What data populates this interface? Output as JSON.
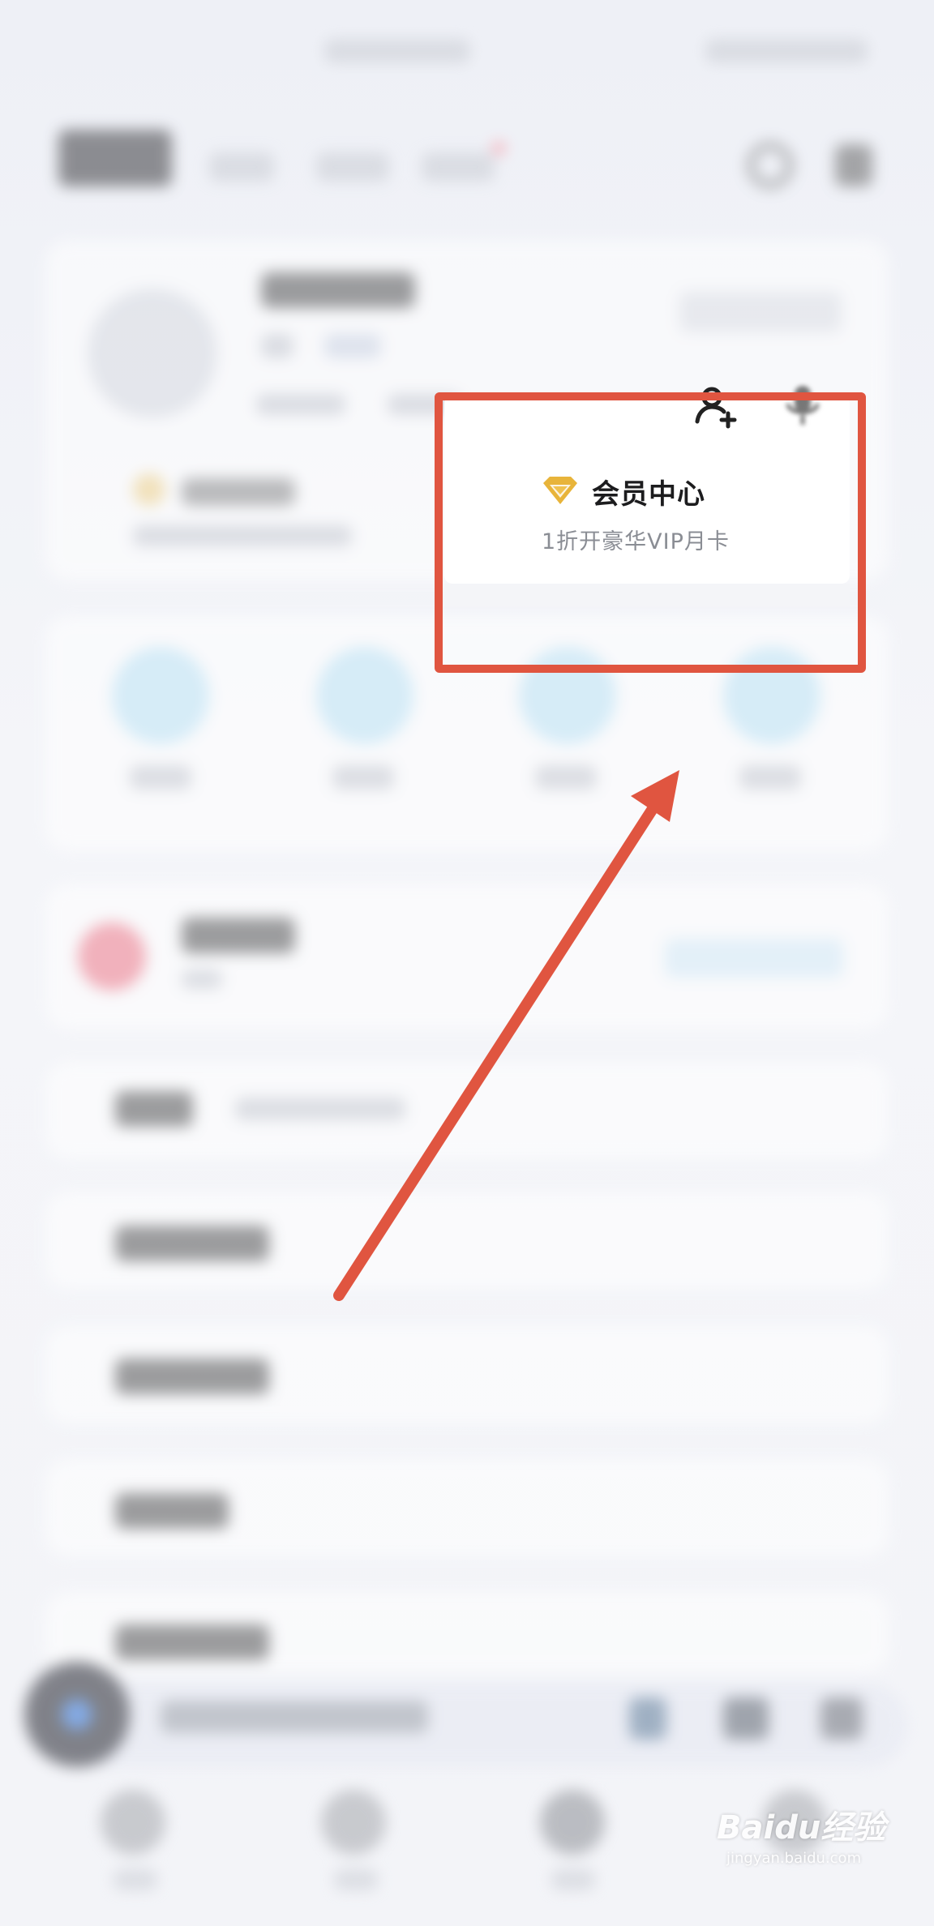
{
  "popup": {
    "title": "会员中心",
    "subtitle": "1折开豪华VIP月卡",
    "icon": "diamond-icon",
    "icon_color": "#e8b43a"
  },
  "top_icons": [
    "add-friend-icon",
    "mic-icon"
  ],
  "annotation": {
    "box_color": "#e05540",
    "arrow_color": "#e05540"
  },
  "watermark": {
    "brand": "Baidu经验",
    "url": "jingyan.baidu.com"
  }
}
